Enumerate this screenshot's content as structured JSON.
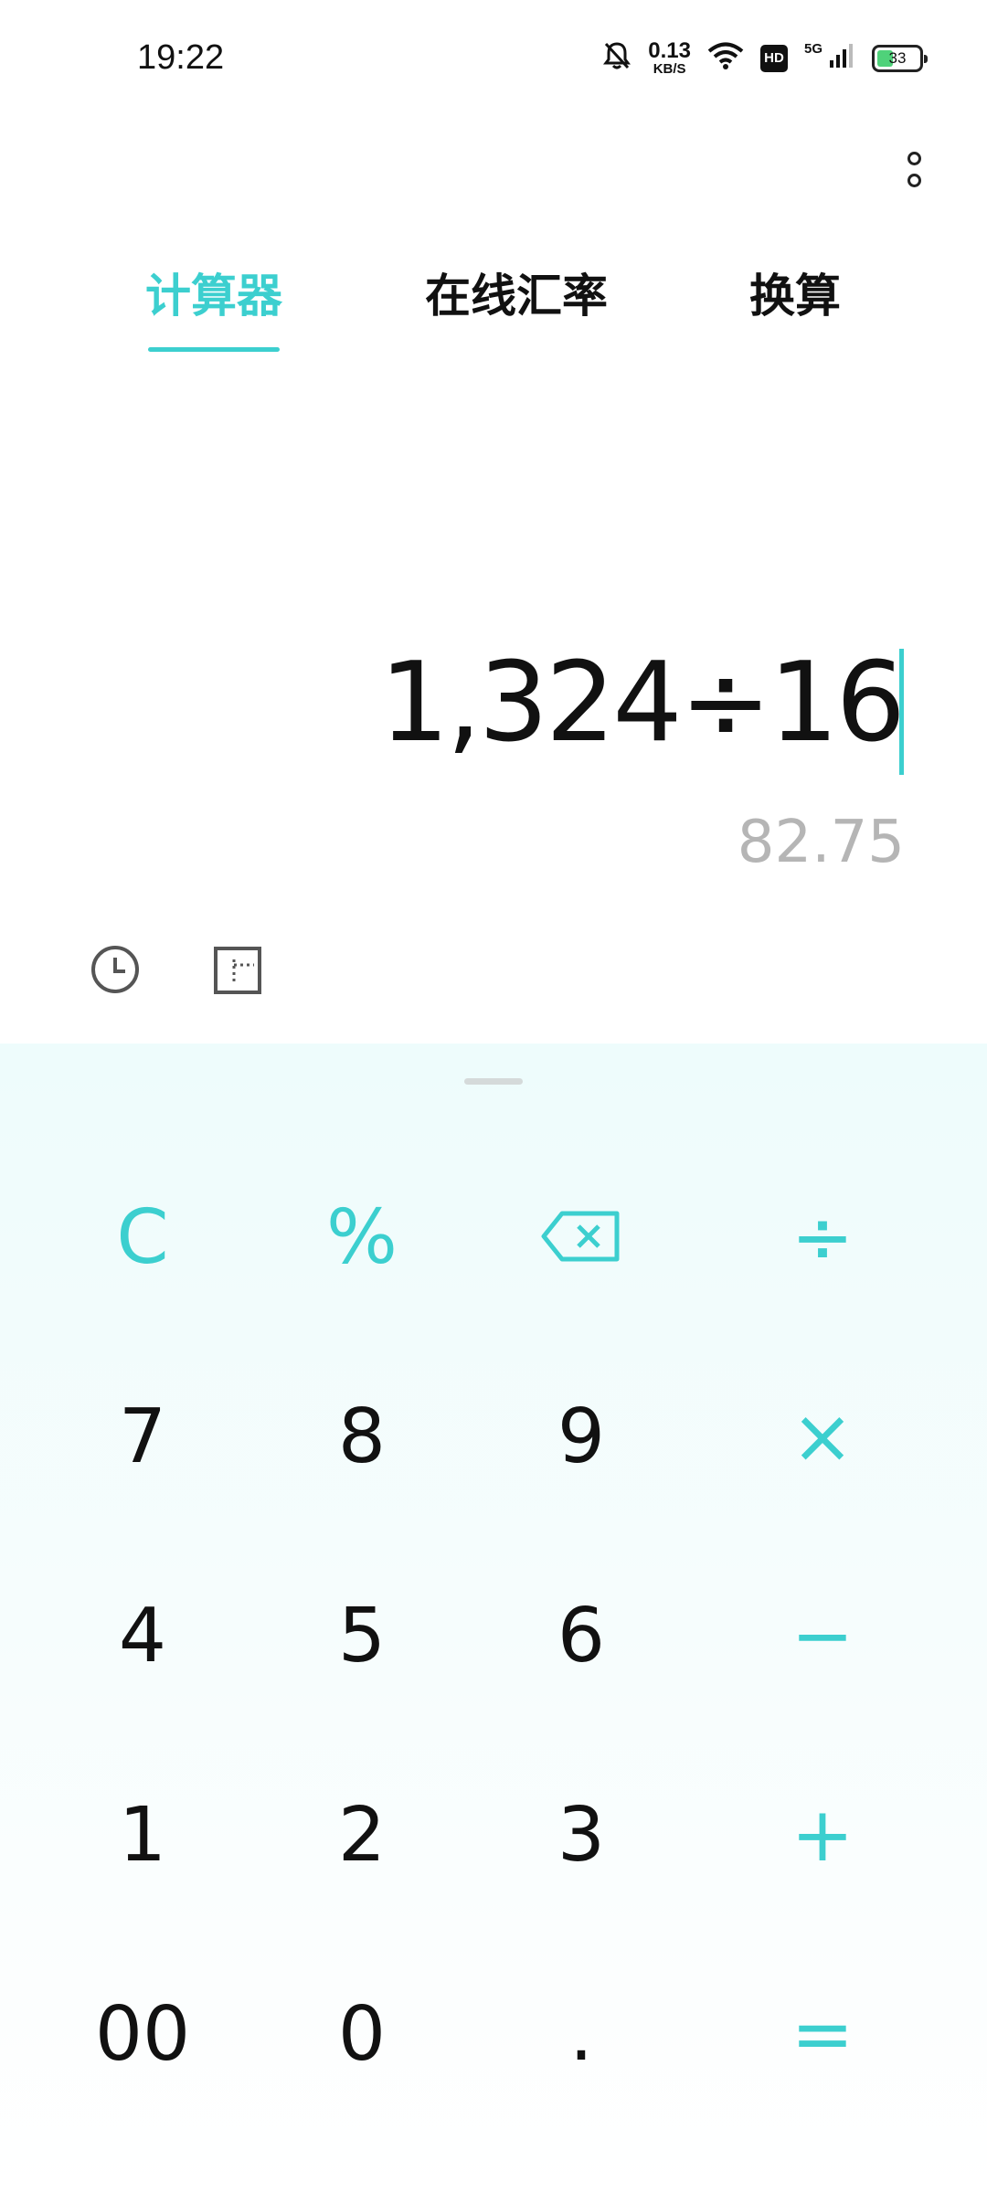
{
  "status_bar": {
    "time": "19:22",
    "net_speed_value": "0.13",
    "net_speed_unit": "KB/S",
    "hd": "HD",
    "network": "5G",
    "battery": "33",
    "icons": [
      "bell-off-icon",
      "wifi-icon",
      "signal-icon",
      "battery-icon"
    ]
  },
  "tabs": [
    {
      "label": "计算器",
      "active": true
    },
    {
      "label": "在线汇率",
      "active": false
    },
    {
      "label": "换算",
      "active": false
    }
  ],
  "display": {
    "expression": "1,324÷16",
    "result": "82.75"
  },
  "keypad": {
    "clear": "C",
    "percent": "%",
    "divide": "÷",
    "multiply": "×",
    "minus": "−",
    "plus": "+",
    "equals": "=",
    "seven": "7",
    "eight": "8",
    "nine": "9",
    "four": "4",
    "five": "5",
    "six": "6",
    "one": "1",
    "two": "2",
    "three": "3",
    "double_zero": "00",
    "zero": "0",
    "dot": "."
  },
  "colors": {
    "accent": "#3ccfcf",
    "result_text": "#b5b5b5",
    "keypad_bg": "#eefcfc"
  }
}
